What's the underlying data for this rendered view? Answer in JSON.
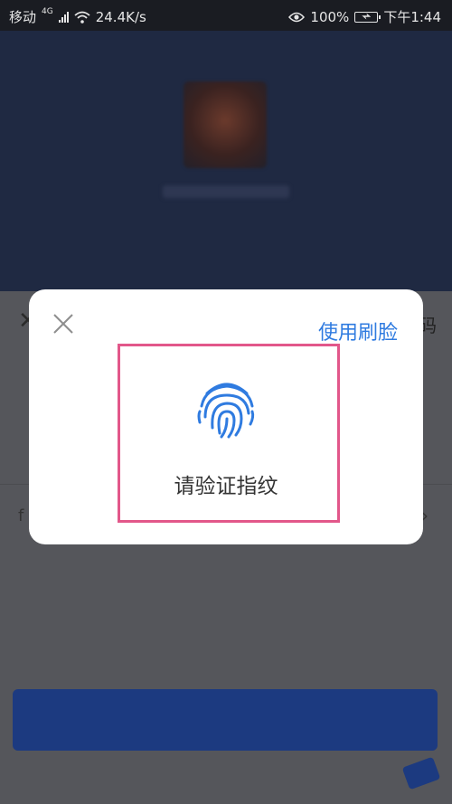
{
  "status_bar": {
    "carrier": "移动",
    "network": "4G",
    "speed": "24.4K/s",
    "battery": "100%",
    "time": "下午1:44"
  },
  "background": {
    "right_fragment": "码"
  },
  "modal": {
    "face_link_label": "使用刷脸",
    "prompt": "请验证指纹"
  },
  "colors": {
    "accent": "#2f7be0",
    "highlight": "#e2578a",
    "fingerprint": "#2f7be0"
  }
}
